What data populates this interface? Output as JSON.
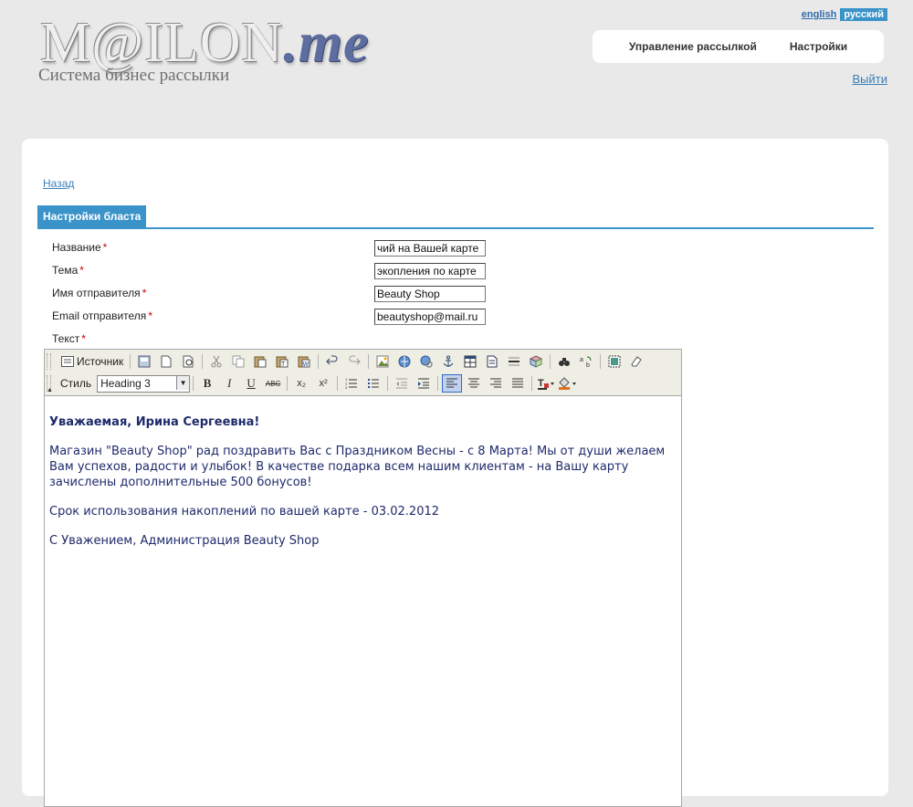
{
  "brand": {
    "logo_main": "M@ILON",
    "logo_suffix": ".me",
    "tagline": "Система бизнес рассылки"
  },
  "languages": {
    "english": "english",
    "russian": "русский"
  },
  "nav": {
    "items": [
      "Управление рассылкой",
      "Настройки"
    ]
  },
  "logout_label": "Выйти",
  "back_label": "Назад",
  "section_title": "Настройки бласта",
  "form": {
    "name_label": "Название",
    "name_value": "чий на Вашей карте",
    "subject_label": "Тема",
    "subject_value": "экопления по карте",
    "sender_name_label": "Имя отправителя",
    "sender_name_value": "Beauty Shop",
    "sender_email_label": "Email отправителя",
    "sender_email_value": "beautyshop@mail.ru",
    "text_label": "Текст",
    "required_mark": "*"
  },
  "editor": {
    "source_label": "Источник",
    "style_label": "Стиль",
    "style_value": "Heading 3",
    "toolbar_glyphs": {
      "bold": "B",
      "italic": "I",
      "underline": "U",
      "strike": "ABC",
      "subscript": "x₂",
      "superscript": "x²"
    },
    "content": [
      "Уважаемая, Ирина Сергеевна!",
      "Магазин \"Beauty Shop\" рад поздравить Вас с Праздником Весны - с 8 Марта! Мы от души желаем Вам успехов, радости и улыбок! В качестве подарка всем нашим клиентам - на Вашу карту зачислены дополнительные 500 бонусов!",
      "Срок использования накоплений по вашей карте - 03.02.2012",
      "С Уважением, Администрация Beauty Shop"
    ]
  },
  "colors": {
    "accent": "#3a93c9",
    "link": "#3b7fb8",
    "required": "#cc0000",
    "editor_text": "#1f2a6b",
    "page_bg": "#e9e9e9"
  }
}
